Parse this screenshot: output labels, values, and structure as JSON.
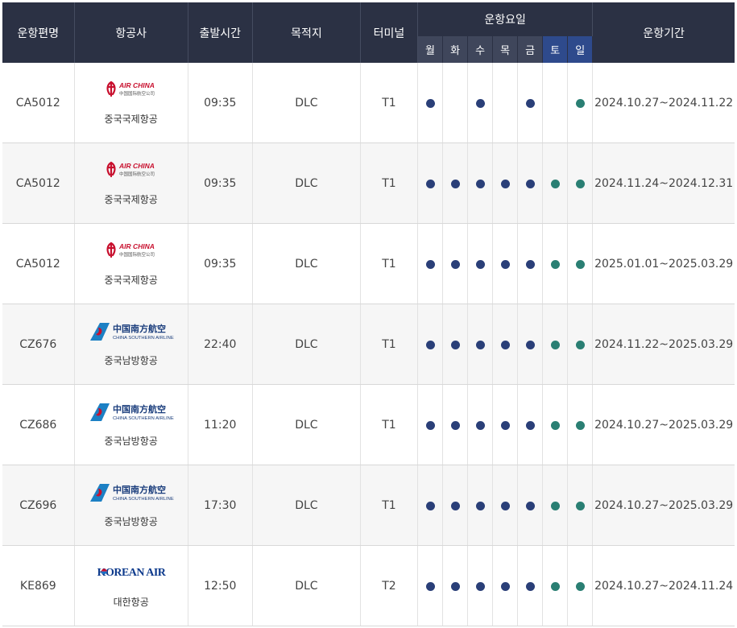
{
  "headers": {
    "flight": "운항편명",
    "airline": "항공사",
    "dep_time": "출발시간",
    "destination": "목적지",
    "terminal": "터미널",
    "days": "운항요일",
    "period": "운항기간"
  },
  "day_labels": [
    "월",
    "화",
    "수",
    "목",
    "금",
    "토",
    "일"
  ],
  "colors": {
    "weekday_dot": "#2a3f78",
    "weekend_dot": "#2a7f73",
    "header_bg": "#2b3144",
    "weekend_header_bg": "#2e4a8c"
  },
  "logos": {
    "airchina": {
      "icon": "air-china-logo",
      "text": "AIR CHINA",
      "sub": "中国国际航空公司"
    },
    "csair": {
      "icon": "china-southern-logo",
      "text": "中国南方航空",
      "sub": "CHINA SOUTHERN AIRLINES"
    },
    "korean": {
      "icon": "korean-air-logo",
      "text": "KOREAN AIR"
    }
  },
  "rows": [
    {
      "flight": "CA5012",
      "logo": "airchina",
      "airline": "중국국제항공",
      "time": "09:35",
      "dest": "DLC",
      "terminal": "T1",
      "days": [
        1,
        0,
        1,
        0,
        1,
        0,
        1
      ],
      "period": "2024.10.27~2024.11.22"
    },
    {
      "flight": "CA5012",
      "logo": "airchina",
      "airline": "중국국제항공",
      "time": "09:35",
      "dest": "DLC",
      "terminal": "T1",
      "days": [
        1,
        1,
        1,
        1,
        1,
        1,
        1
      ],
      "period": "2024.11.24~2024.12.31"
    },
    {
      "flight": "CA5012",
      "logo": "airchina",
      "airline": "중국국제항공",
      "time": "09:35",
      "dest": "DLC",
      "terminal": "T1",
      "days": [
        1,
        1,
        1,
        1,
        1,
        1,
        1
      ],
      "period": "2025.01.01~2025.03.29"
    },
    {
      "flight": "CZ676",
      "logo": "csair",
      "airline": "중국남방항공",
      "time": "22:40",
      "dest": "DLC",
      "terminal": "T1",
      "days": [
        1,
        1,
        1,
        1,
        1,
        1,
        1
      ],
      "period": "2024.11.22~2025.03.29"
    },
    {
      "flight": "CZ686",
      "logo": "csair",
      "airline": "중국남방항공",
      "time": "11:20",
      "dest": "DLC",
      "terminal": "T1",
      "days": [
        1,
        1,
        1,
        1,
        1,
        1,
        1
      ],
      "period": "2024.10.27~2025.03.29"
    },
    {
      "flight": "CZ696",
      "logo": "csair",
      "airline": "중국남방항공",
      "time": "17:30",
      "dest": "DLC",
      "terminal": "T1",
      "days": [
        1,
        1,
        1,
        1,
        1,
        1,
        1
      ],
      "period": "2024.10.27~2025.03.29"
    },
    {
      "flight": "KE869",
      "logo": "korean",
      "airline": "대한항공",
      "time": "12:50",
      "dest": "DLC",
      "terminal": "T2",
      "days": [
        1,
        1,
        1,
        1,
        1,
        1,
        1
      ],
      "period": "2024.10.27~2024.11.24"
    }
  ]
}
